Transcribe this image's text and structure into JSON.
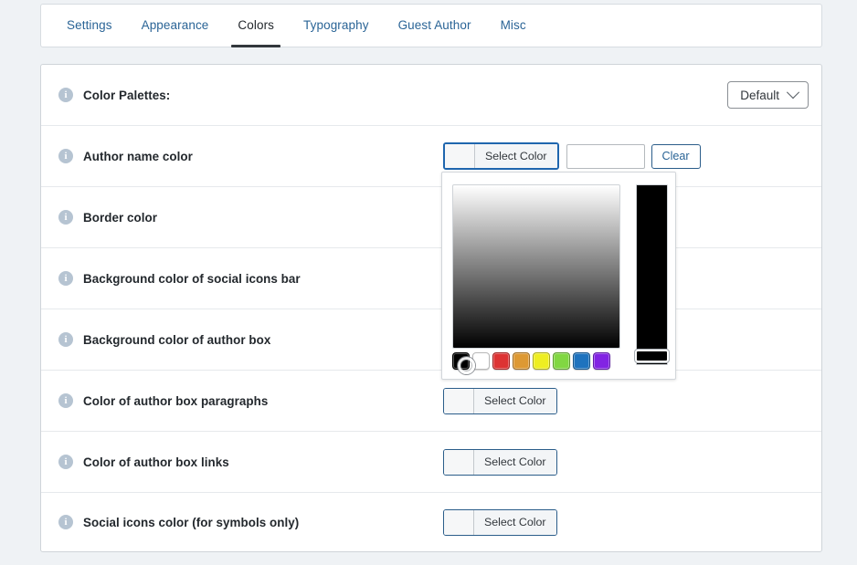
{
  "tabs": [
    {
      "label": "Settings",
      "active": false
    },
    {
      "label": "Appearance",
      "active": false
    },
    {
      "label": "Colors",
      "active": true
    },
    {
      "label": "Typography",
      "active": false
    },
    {
      "label": "Guest Author",
      "active": false
    },
    {
      "label": "Misc",
      "active": false
    }
  ],
  "rows": [
    {
      "label": "Color Palettes:",
      "control": "select",
      "value": "Default"
    },
    {
      "label": "Author name color",
      "control": "color-active",
      "button_label": "Select Color",
      "input_value": "",
      "clear_label": "Clear",
      "swatch": "#f6f7f8"
    },
    {
      "label": "Border color",
      "control": "none"
    },
    {
      "label": "Background color of social icons bar",
      "control": "none"
    },
    {
      "label": "Background color of author box",
      "control": "none"
    },
    {
      "label": "Color of author box paragraphs",
      "control": "color",
      "button_label": "Select Color",
      "swatch": "#f6f7f8"
    },
    {
      "label": "Color of author box links",
      "control": "color",
      "button_label": "Select Color",
      "swatch": "#f6f7f8"
    },
    {
      "label": "Social icons color (for symbols only)",
      "control": "color",
      "button_label": "Select Color",
      "swatch": "#f6f7f8"
    }
  ],
  "info_icon_glyph": "i",
  "picker": {
    "open": true,
    "for_row": "Author name color",
    "current_color": "#000000",
    "hue_strip_color": "#000000",
    "swatches": [
      {
        "name": "black",
        "hex": "#000000"
      },
      {
        "name": "white",
        "hex": "#ffffff"
      },
      {
        "name": "red",
        "hex": "#dd3333"
      },
      {
        "name": "orange",
        "hex": "#dd9933"
      },
      {
        "name": "yellow",
        "hex": "#eeee22"
      },
      {
        "name": "green",
        "hex": "#81d742"
      },
      {
        "name": "blue",
        "hex": "#1e73be"
      },
      {
        "name": "purple",
        "hex": "#8224e3"
      }
    ]
  },
  "theme": {
    "page_bg": "#eff2f5",
    "card_bg": "#ffffff",
    "link_blue": "#2a6496",
    "active_tab": "#23282d",
    "border": "#cfd4d9",
    "info_icon": "#b6c4d2"
  }
}
